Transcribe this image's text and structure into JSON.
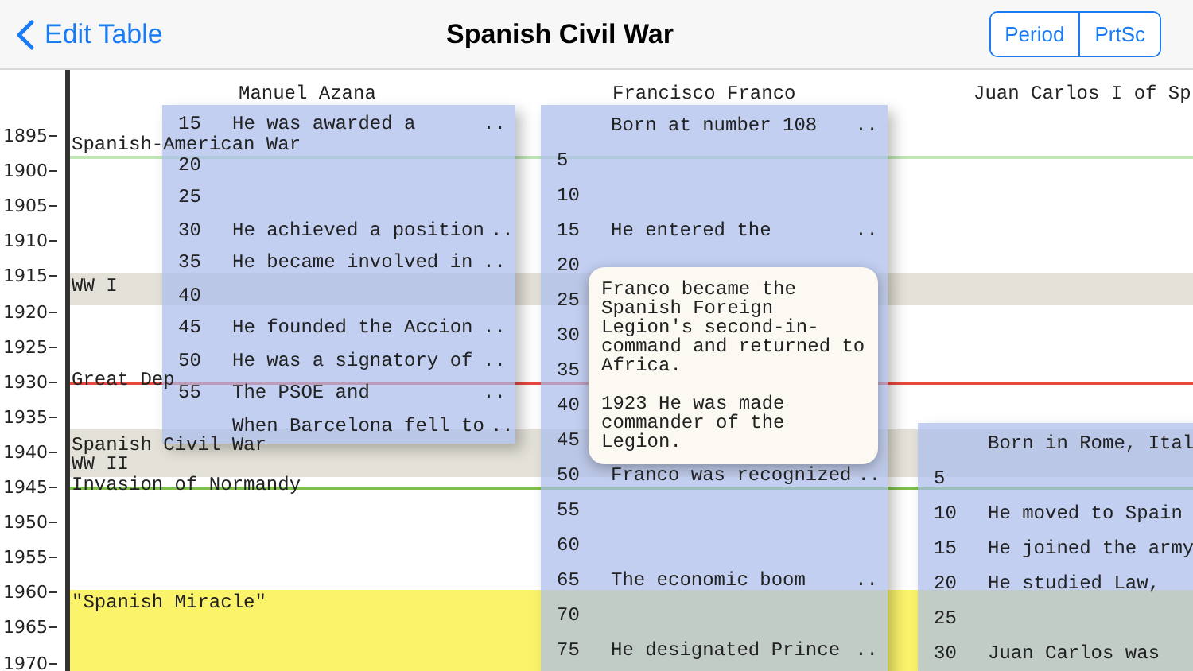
{
  "nav": {
    "back": "Edit Table",
    "title": "Spanish Civil War",
    "buttons": [
      "Period",
      "PrtSc"
    ]
  },
  "axis": {
    "years": [
      "1895",
      "1900",
      "1905",
      "1910",
      "1915",
      "1920",
      "1925",
      "1930",
      "1935",
      "1940",
      "1945",
      "1950",
      "1955",
      "1960",
      "1965",
      "1970"
    ]
  },
  "periods": [
    {
      "kind": "line",
      "label": "Spanish-American War",
      "color": "#bfe8b5"
    },
    {
      "kind": "band",
      "label": "WW I",
      "color": "#e4e2d8"
    },
    {
      "kind": "line",
      "label": "Great Dep",
      "color": "#e8493f"
    },
    {
      "kind": "band",
      "label": "Spanish Civil War",
      "color": "#e4e2d8"
    },
    {
      "kind": "band",
      "label": "WW II",
      "color": "#e4e2d8"
    },
    {
      "kind": "line",
      "label": "Invasion of Normandy",
      "color": "#7fbf4a"
    },
    {
      "kind": "band",
      "label": "\"Spanish Miracle\"",
      "color": "#fbf36a"
    }
  ],
  "columns": [
    {
      "name": "Manuel Azana",
      "rows": [
        {
          "age": "15",
          "entry": "He was awarded a",
          "more": ".."
        },
        {
          "age": "20"
        },
        {
          "age": "25"
        },
        {
          "age": "30",
          "entry": "He achieved a position",
          "more": ".."
        },
        {
          "age": "35",
          "entry": "He became involved in",
          "more": ".."
        },
        {
          "age": "40"
        },
        {
          "age": "45",
          "entry": "He founded the Accion",
          "more": ".."
        },
        {
          "age": "50",
          "entry": "He was a signatory of",
          "more": ".."
        },
        {
          "age": "55",
          "entry": "The PSOE and",
          "more": ".."
        },
        {
          "entry": "When Barcelona fell to",
          "more": ".."
        }
      ]
    },
    {
      "name": "Francisco Franco",
      "rows": [
        {
          "entry": "Born at number 108",
          "more": ".."
        },
        {
          "age": "5"
        },
        {
          "age": "10"
        },
        {
          "age": "15",
          "entry": "He entered the",
          "more": ".."
        },
        {
          "age": "20"
        },
        {
          "age": "25"
        },
        {
          "age": "30"
        },
        {
          "age": "35"
        },
        {
          "age": "40"
        },
        {
          "age": "45"
        },
        {
          "age": "50",
          "entry": "Franco was recognized",
          "more": ".."
        },
        {
          "age": "55"
        },
        {
          "age": "60"
        },
        {
          "age": "65",
          "entry": "The economic boom",
          "more": ".."
        },
        {
          "age": "70"
        },
        {
          "age": "75",
          "entry": "He designated Prince",
          "more": ".."
        }
      ]
    },
    {
      "name": "Juan Carlos I of Sp",
      "rows": [
        {
          "entry": "Born in Rome, Ital"
        },
        {
          "age": "5"
        },
        {
          "age": "10",
          "entry": "He moved to Spain"
        },
        {
          "age": "15",
          "entry": "He joined the army"
        },
        {
          "age": "20",
          "entry": "He studied Law,"
        },
        {
          "age": "25"
        },
        {
          "age": "30",
          "entry": "Juan Carlos was"
        }
      ]
    }
  ],
  "popup": {
    "paragraphs": [
      "Franco became the Spanish Foreign Legion's second-in-command and returned to Africa.",
      "1923 He was made commander of the Legion."
    ]
  }
}
